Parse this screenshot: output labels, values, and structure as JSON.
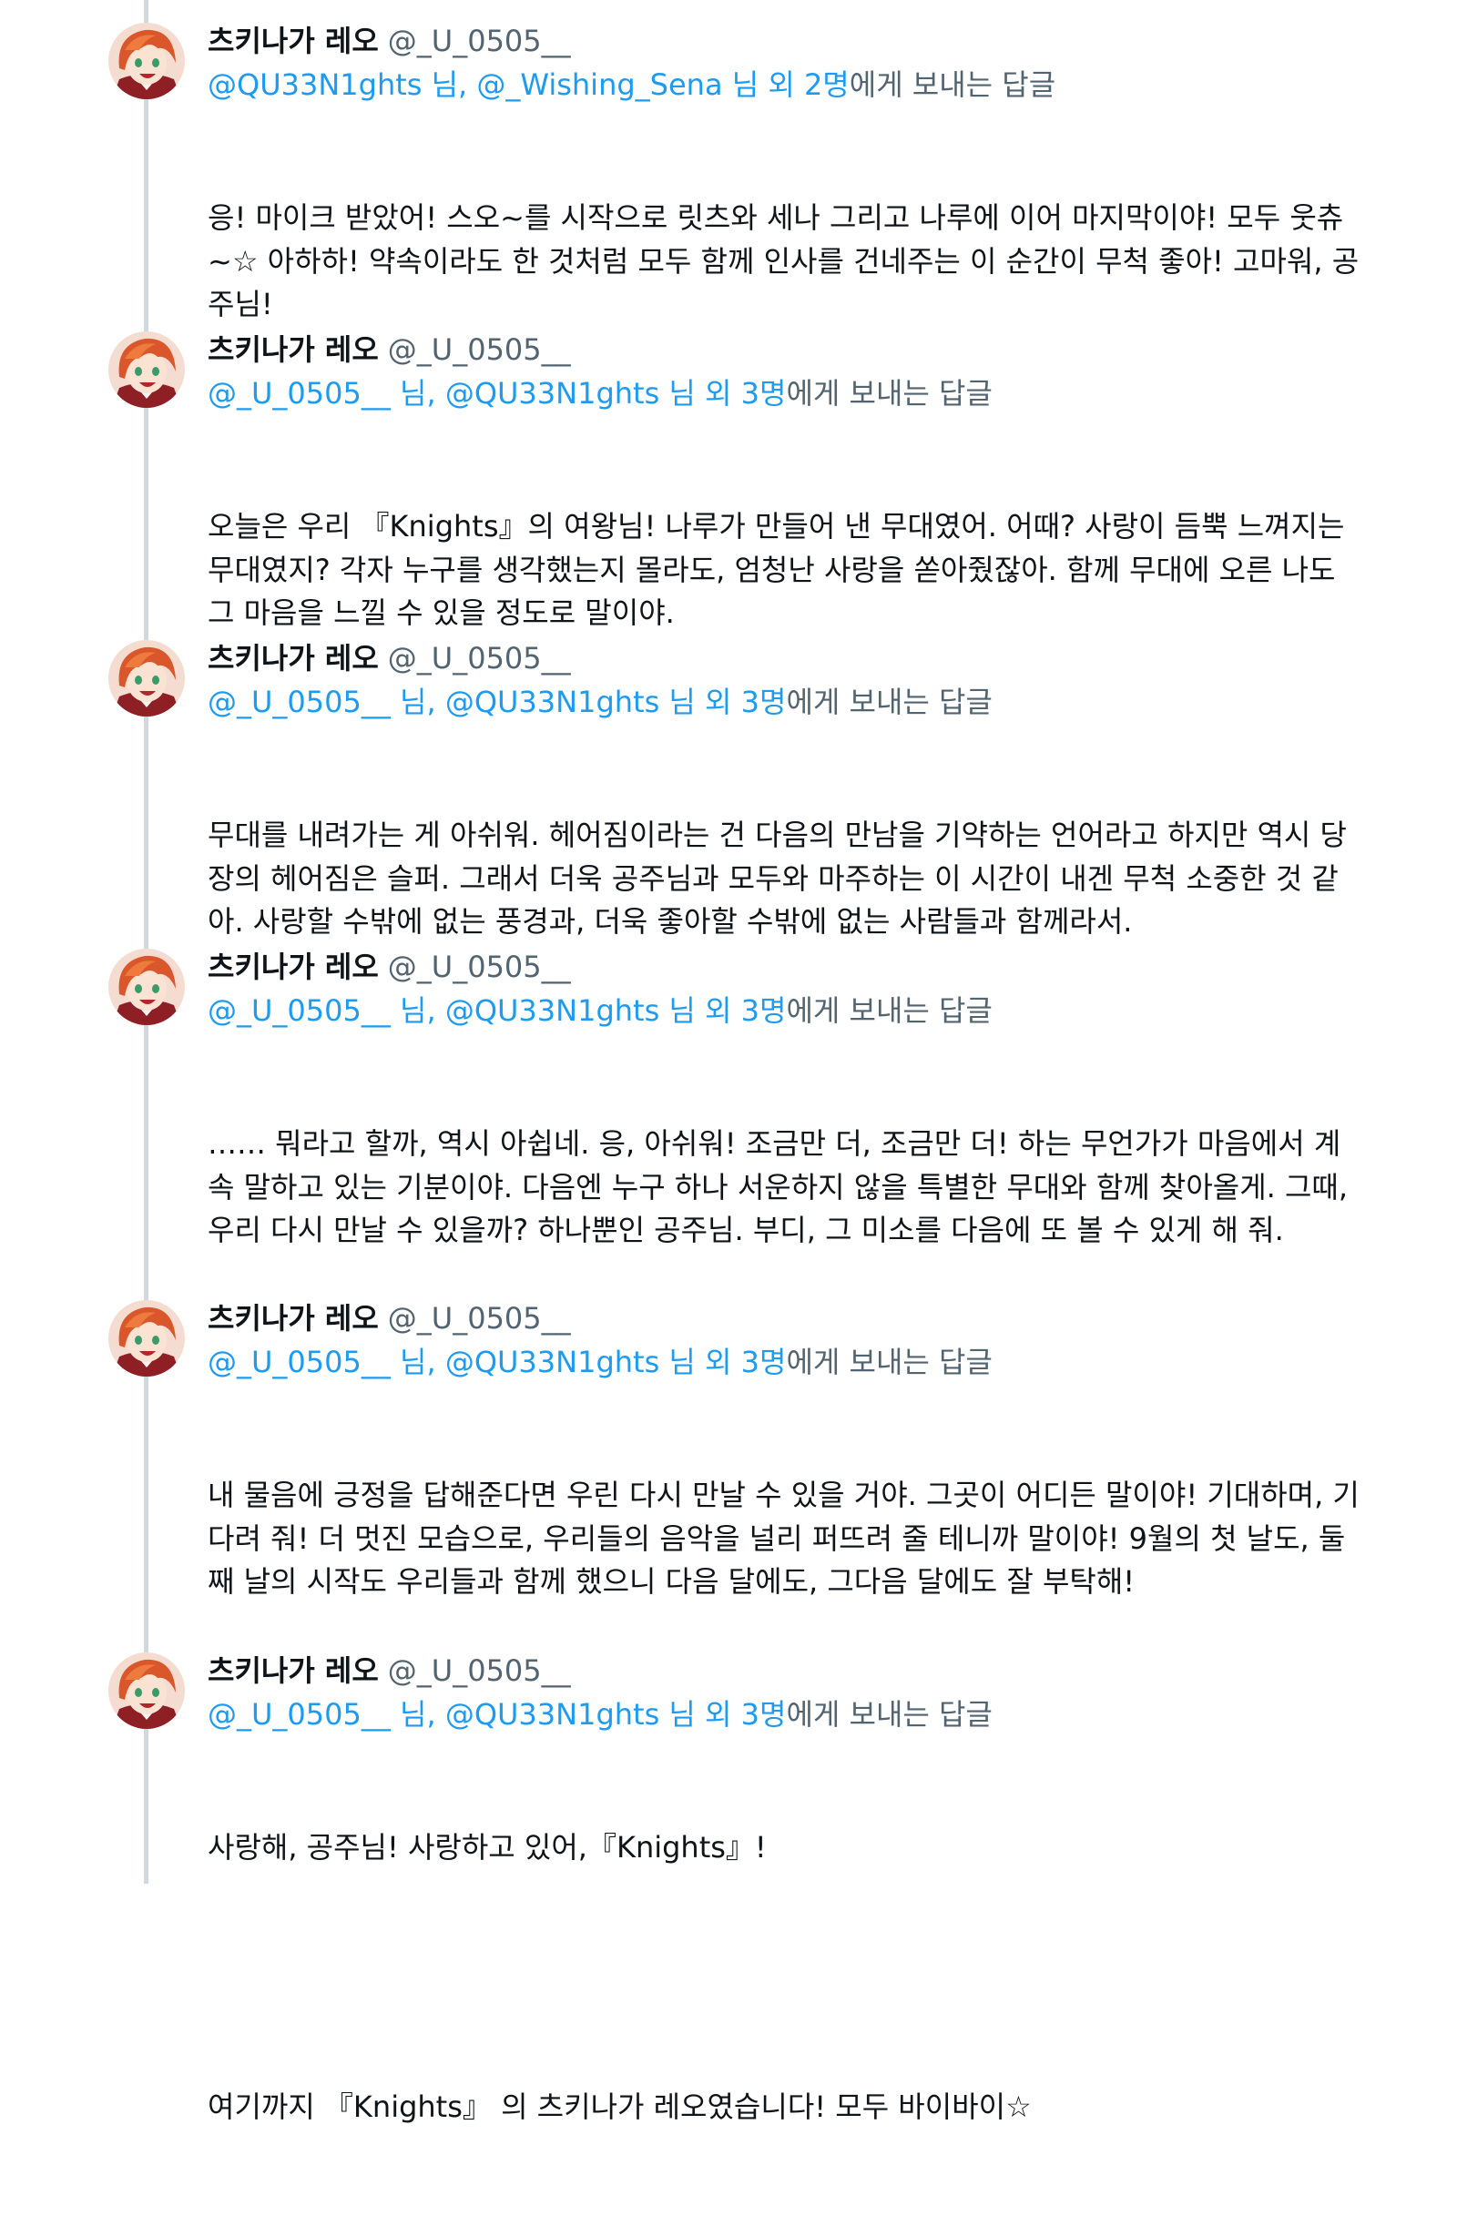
{
  "thread": {
    "tweets": [
      {
        "display_name": "츠키나가 레오",
        "handle": "@_U_0505__",
        "reply": {
          "mentions": "@QU33N1ghts 님, @_Wishing_Sena 님 외 2명",
          "suffix": "에게 보내는 답글"
        },
        "text": "응! 마이크 받았어! 스오~를 시작으로 릿츠와 세나 그리고 나루에 이어 마지막이야! 모두 웃츄~☆ 아하하! 약속이라도 한 것처럼 모두 함께 인사를 건네주는 이 순간이 무척 좋아! 고마워, 공주님!"
      },
      {
        "display_name": "츠키나가 레오",
        "handle": "@_U_0505__",
        "reply": {
          "mentions": "@_U_0505__ 님, @QU33N1ghts 님 외 3명",
          "suffix": "에게 보내는 답글"
        },
        "text": "오늘은 우리 『Knights』의 여왕님! 나루가 만들어 낸 무대였어. 어때? 사랑이 듬뿍 느껴지는 무대였지? 각자 누구를 생각했는지 몰라도, 엄청난 사랑을 쏟아줬잖아. 함께 무대에 오른 나도 그 마음을 느낄 수 있을 정도로 말이야."
      },
      {
        "display_name": "츠키나가 레오",
        "handle": "@_U_0505__",
        "reply": {
          "mentions": "@_U_0505__ 님, @QU33N1ghts 님 외 3명",
          "suffix": "에게 보내는 답글"
        },
        "text": "무대를 내려가는 게 아쉬워. 헤어짐이라는 건 다음의 만남을 기약하는 언어라고 하지만 역시 당장의 헤어짐은 슬퍼. 그래서 더욱 공주님과 모두와 마주하는 이 시간이 내겐 무척 소중한 것 같아. 사랑할 수밖에 없는 풍경과, 더욱 좋아할 수밖에 없는 사람들과 함께라서."
      },
      {
        "display_name": "츠키나가 레오",
        "handle": "@_U_0505__",
        "reply": {
          "mentions": "@_U_0505__ 님, @QU33N1ghts 님 외 3명",
          "suffix": "에게 보내는 답글"
        },
        "text": "…… 뭐라고 할까, 역시 아쉽네. 응, 아쉬워! 조금만 더, 조금만 더! 하는 무언가가 마음에서 계속 말하고 있는 기분이야. 다음엔 누구 하나 서운하지 않을 특별한 무대와 함께 찾아올게. 그때, 우리 다시 만날 수 있을까? 하나뿐인 공주님. 부디, 그 미소를 다음에 또 볼 수 있게 해 줘."
      },
      {
        "display_name": "츠키나가 레오",
        "handle": "@_U_0505__",
        "reply": {
          "mentions": "@_U_0505__ 님, @QU33N1ghts 님 외 3명",
          "suffix": "에게 보내는 답글"
        },
        "text": "내 물음에 긍정을 답해준다면 우린 다시 만날 수 있을 거야. 그곳이 어디든 말이야! 기대하며, 기다려 줘! 더 멋진 모습으로, 우리들의 음악을 널리 퍼뜨려 줄 테니까 말이야! 9월의 첫 날도, 둘째 날의 시작도 우리들과 함께 했으니 다음 달에도, 그다음 달에도 잘 부탁해!"
      },
      {
        "display_name": "츠키나가 레오",
        "handle": "@_U_0505__",
        "reply": {
          "mentions": "@_U_0505__ 님, @QU33N1ghts 님 외 3명",
          "suffix": "에게 보내는 답글"
        },
        "text": "사랑해, 공주님! 사랑하고 있어,『Knights』!",
        "text2": "여기까지 『Knights』 의 츠키나가 레오였습니다! 모두 바이바이☆"
      }
    ]
  },
  "colors": {
    "text": "#0f1419",
    "secondary": "#536471",
    "link": "#1d9bf0",
    "thread_line": "#cfd9de"
  }
}
